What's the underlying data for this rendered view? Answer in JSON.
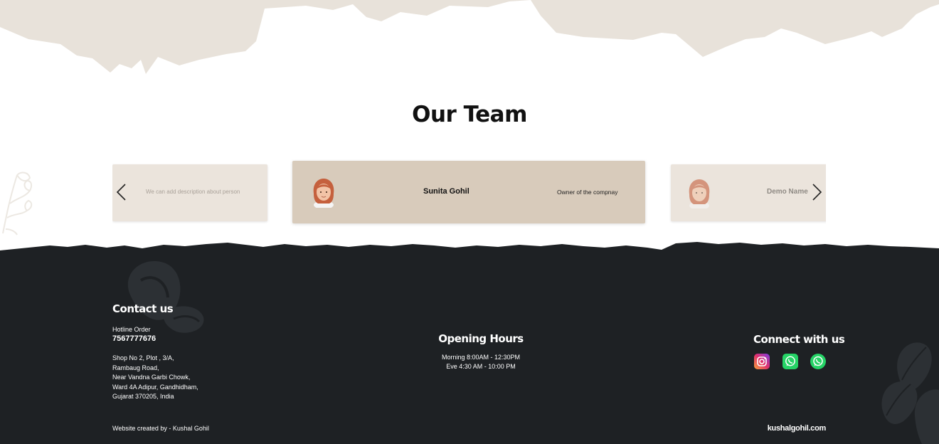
{
  "team": {
    "title": "Our Team",
    "prev_label": "Previous",
    "next_label": "Next",
    "members": [
      {
        "description": "We can add description about person"
      },
      {
        "name": "Sunita Gohil",
        "role": "Owner of the compnay"
      },
      {
        "name": "Demo Name"
      }
    ]
  },
  "footer": {
    "contact": {
      "heading": "Contact us",
      "hotline_label": "Hotline Order",
      "hotline_number": "7567777676",
      "address_lines": [
        "Shop No 2, Plot , 3/A,",
        "Rambaug Road,",
        "Near Vandna Garbi Chowk,",
        "Ward 4A Adipur, Gandhidham,",
        "Gujarat 370205, India"
      ]
    },
    "hours": {
      "heading": "Opening Hours",
      "morning": "Morning 8:00AM - 12:30PM",
      "evening": "Eve 4:30 AM - 10:00 PM"
    },
    "connect": {
      "heading": "Connect with us",
      "icons": [
        "instagram-icon",
        "whatsapp-icon",
        "whatsapp-icon"
      ]
    },
    "credit": "Website created by - Kushal Gohil",
    "site": "kushalgohil.com"
  },
  "colors": {
    "beige_deco": "#e8e2da",
    "card": "#ebe4dc",
    "card_active": "#d8cbbb",
    "footer_bg": "#1e2124",
    "accent_whatsapp": "#25d366"
  }
}
